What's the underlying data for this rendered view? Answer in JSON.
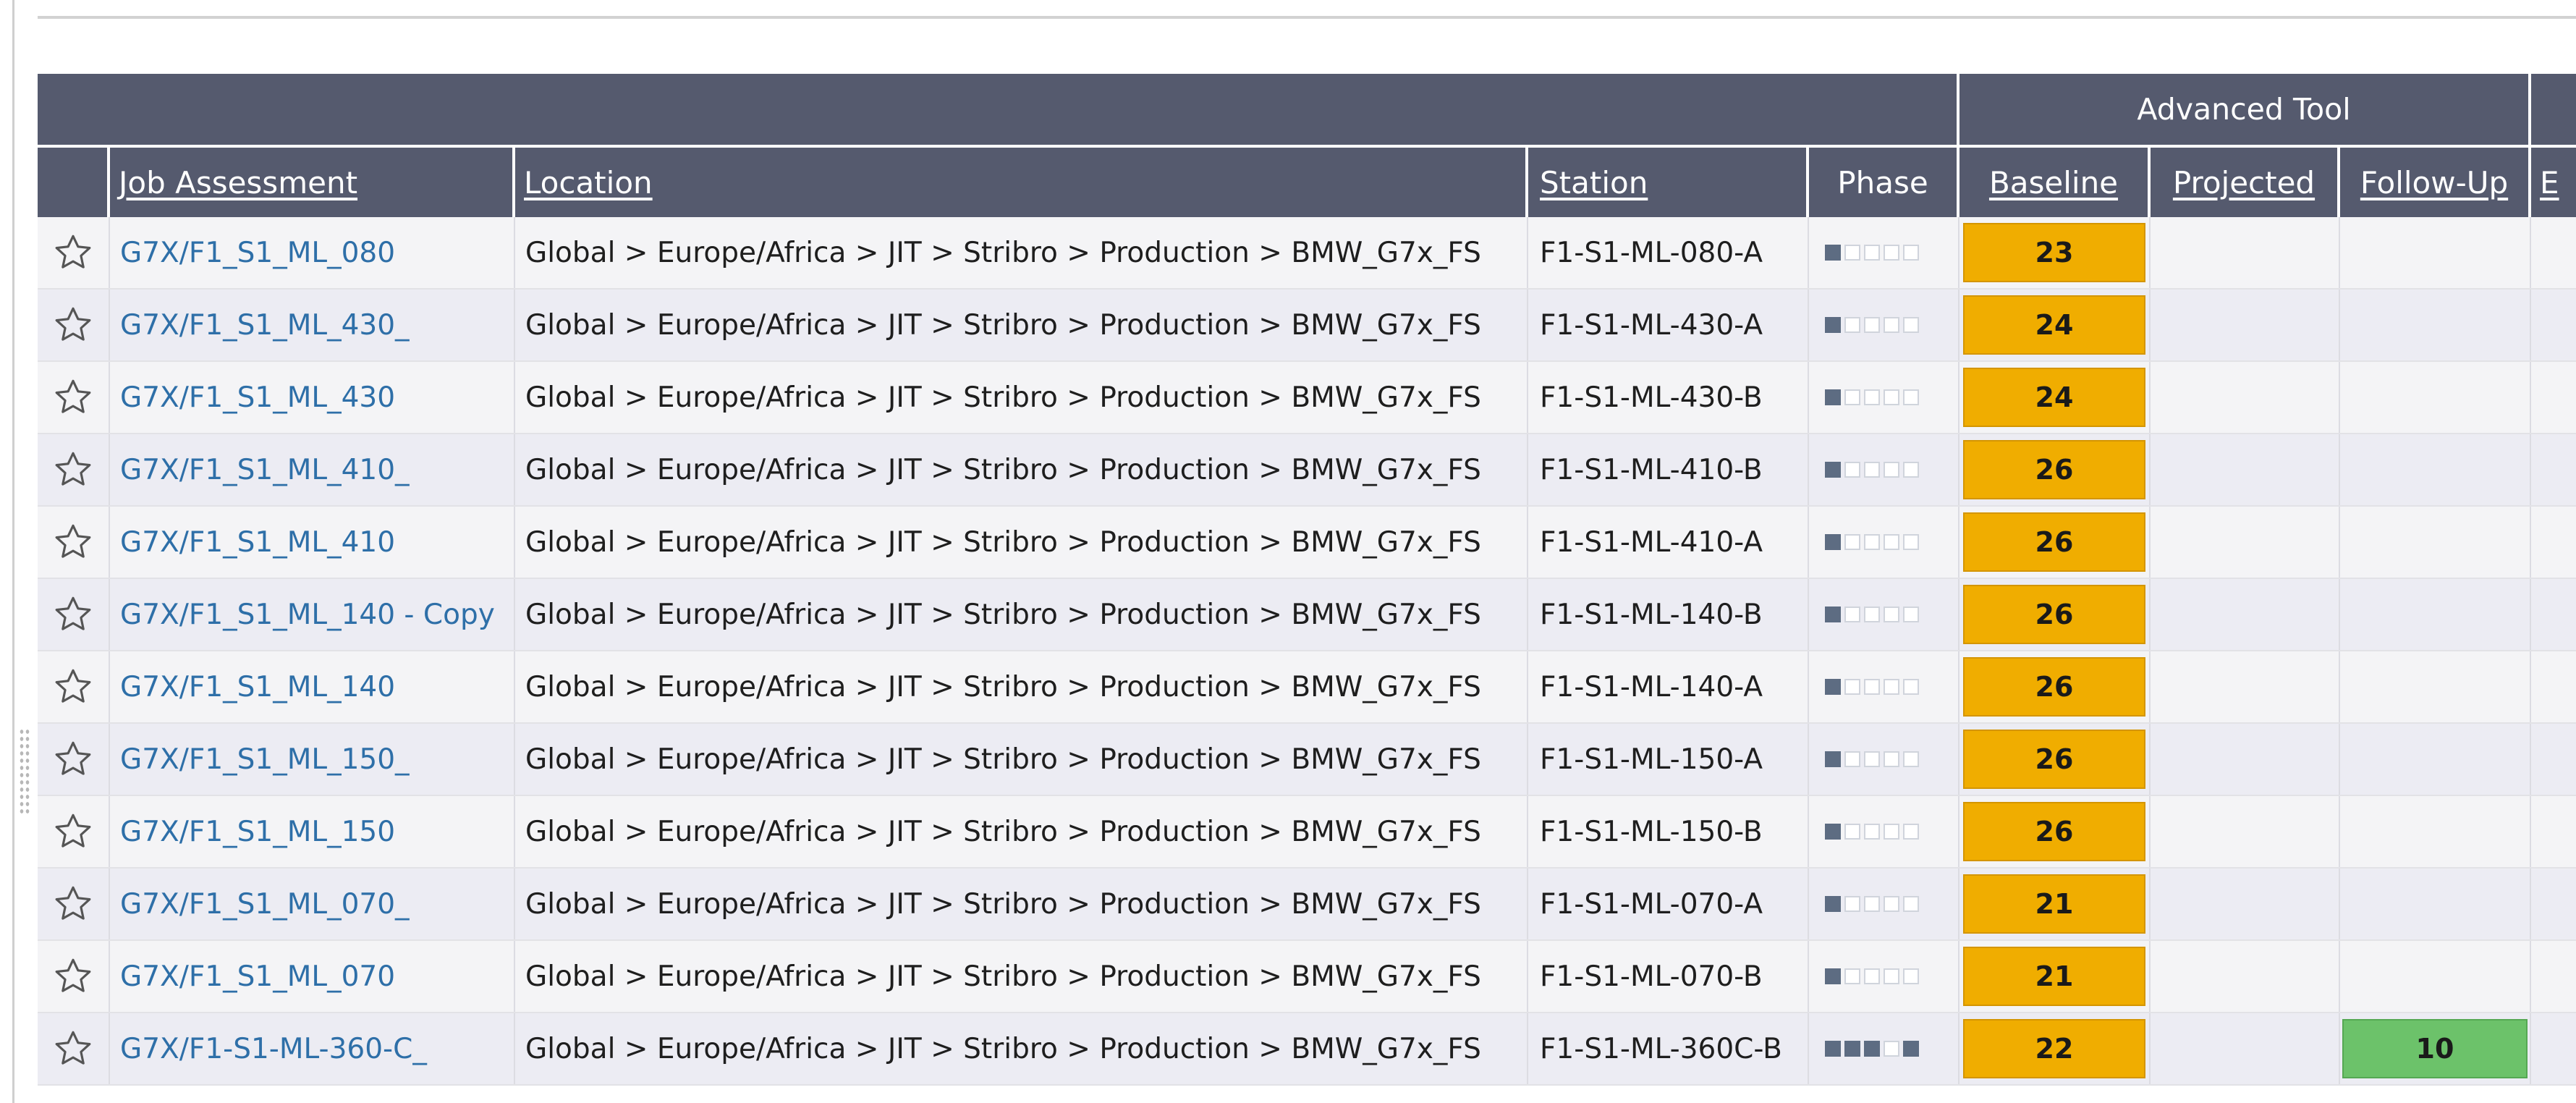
{
  "group_header": {
    "advanced_tool": "Advanced Tool"
  },
  "columns": {
    "job_assessment": "Job Assessment",
    "location": "Location",
    "station": "Station",
    "phase": "Phase",
    "baseline": "Baseline",
    "projected": "Projected",
    "follow_up": "Follow-Up",
    "next_cut": "E"
  },
  "colors": {
    "header_bg": "#555a6e",
    "score_amber": "#f0ad00",
    "score_green": "#6cc26a",
    "link": "#2e6fa8",
    "phase_filled": "#5d6c82"
  },
  "rows": [
    {
      "job": "G7X/F1_S1_ML_080",
      "location": "Global > Europe/Africa > JIT > Stribro > Production > BMW_G7x_FS",
      "station": "F1-S1-ML-080-A",
      "phase": [
        1,
        0,
        0,
        0,
        0
      ],
      "baseline": "23",
      "projected": "",
      "follow_up": ""
    },
    {
      "job": "G7X/F1_S1_ML_430_",
      "location": "Global > Europe/Africa > JIT > Stribro > Production > BMW_G7x_FS",
      "station": "F1-S1-ML-430-A",
      "phase": [
        1,
        0,
        0,
        0,
        0
      ],
      "baseline": "24",
      "projected": "",
      "follow_up": ""
    },
    {
      "job": "G7X/F1_S1_ML_430",
      "location": "Global > Europe/Africa > JIT > Stribro > Production > BMW_G7x_FS",
      "station": "F1-S1-ML-430-B",
      "phase": [
        1,
        0,
        0,
        0,
        0
      ],
      "baseline": "24",
      "projected": "",
      "follow_up": ""
    },
    {
      "job": "G7X/F1_S1_ML_410_",
      "location": "Global > Europe/Africa > JIT > Stribro > Production > BMW_G7x_FS",
      "station": "F1-S1-ML-410-B",
      "phase": [
        1,
        0,
        0,
        0,
        0
      ],
      "baseline": "26",
      "projected": "",
      "follow_up": ""
    },
    {
      "job": "G7X/F1_S1_ML_410",
      "location": "Global > Europe/Africa > JIT > Stribro > Production > BMW_G7x_FS",
      "station": "F1-S1-ML-410-A",
      "phase": [
        1,
        0,
        0,
        0,
        0
      ],
      "baseline": "26",
      "projected": "",
      "follow_up": ""
    },
    {
      "job": "G7X/F1_S1_ML_140 - Copy",
      "location": "Global > Europe/Africa > JIT > Stribro > Production > BMW_G7x_FS",
      "station": "F1-S1-ML-140-B",
      "phase": [
        1,
        0,
        0,
        0,
        0
      ],
      "baseline": "26",
      "projected": "",
      "follow_up": ""
    },
    {
      "job": "G7X/F1_S1_ML_140",
      "location": "Global > Europe/Africa > JIT > Stribro > Production > BMW_G7x_FS",
      "station": "F1-S1-ML-140-A",
      "phase": [
        1,
        0,
        0,
        0,
        0
      ],
      "baseline": "26",
      "projected": "",
      "follow_up": ""
    },
    {
      "job": "G7X/F1_S1_ML_150_",
      "location": "Global > Europe/Africa > JIT > Stribro > Production > BMW_G7x_FS",
      "station": "F1-S1-ML-150-A",
      "phase": [
        1,
        0,
        0,
        0,
        0
      ],
      "baseline": "26",
      "projected": "",
      "follow_up": ""
    },
    {
      "job": "G7X/F1_S1_ML_150",
      "location": "Global > Europe/Africa > JIT > Stribro > Production > BMW_G7x_FS",
      "station": "F1-S1-ML-150-B",
      "phase": [
        1,
        0,
        0,
        0,
        0
      ],
      "baseline": "26",
      "projected": "",
      "follow_up": ""
    },
    {
      "job": "G7X/F1_S1_ML_070_",
      "location": "Global > Europe/Africa > JIT > Stribro > Production > BMW_G7x_FS",
      "station": "F1-S1-ML-070-A",
      "phase": [
        1,
        0,
        0,
        0,
        0
      ],
      "baseline": "21",
      "projected": "",
      "follow_up": ""
    },
    {
      "job": "G7X/F1_S1_ML_070",
      "location": "Global > Europe/Africa > JIT > Stribro > Production > BMW_G7x_FS",
      "station": "F1-S1-ML-070-B",
      "phase": [
        1,
        0,
        0,
        0,
        0
      ],
      "baseline": "21",
      "projected": "",
      "follow_up": ""
    },
    {
      "job": "G7X/F1-S1-ML-360-C_",
      "location": "Global > Europe/Africa > JIT > Stribro > Production > BMW_G7x_FS",
      "station": "F1-S1-ML-360C-B",
      "phase": [
        1,
        1,
        1,
        0,
        1
      ],
      "baseline": "22",
      "projected": "",
      "follow_up": "10"
    }
  ]
}
